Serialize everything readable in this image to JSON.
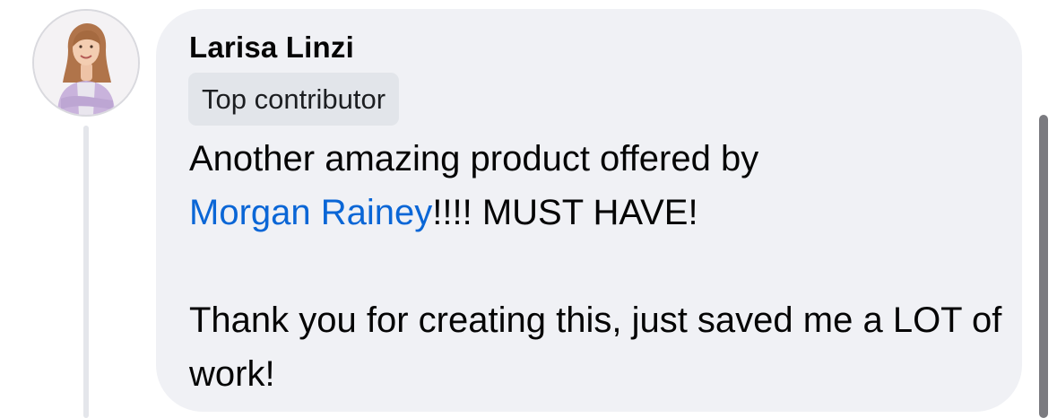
{
  "comment": {
    "author": "Larisa Linzi",
    "badge": "Top contributor",
    "line1": "Another amazing product offered by",
    "mention": "Morgan Rainey",
    "after_mention": "!!!! MUST HAVE!",
    "line3": "Thank you for creating this, just saved me a LOT of work!"
  },
  "icons": {
    "avatar": "profile-photo"
  },
  "colors": {
    "bubble": "#f0f1f5",
    "badge": "#e2e5ea",
    "mention": "#0a66d6",
    "thread_line": "#e4e6eb"
  }
}
